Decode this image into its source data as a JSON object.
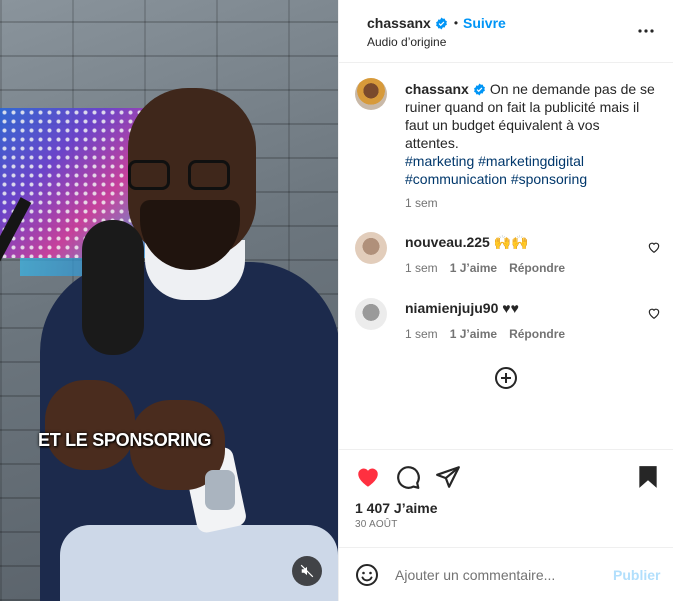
{
  "media": {
    "overlay_text": "ET LE SPONSORING",
    "mute_icon": "speaker-muted-icon"
  },
  "header": {
    "username": "chassanx",
    "separator": "•",
    "follow_label": "Suivre",
    "audio_label": "Audio d’origine",
    "verified_icon": "verified-badge-icon",
    "more_icon": "more-options-icon"
  },
  "caption": {
    "username": "chassanx",
    "text": "On ne demande pas de se ruiner quand on fait la publicité mais il faut un budget équivalent à vos attentes.",
    "hashtags": "#marketing #marketingdigital #communication #sponsoring",
    "time": "1 sem"
  },
  "comments": [
    {
      "username": "nouveau.225",
      "text": "🙌🙌",
      "time": "1 sem",
      "likes": "1 J’aime",
      "reply": "Répondre"
    },
    {
      "username": "niamienjuju90",
      "text": "♥♥",
      "time": "1 sem",
      "likes": "1 J’aime",
      "reply": "Répondre"
    }
  ],
  "actions": {
    "likes": "1 407 J’aime",
    "date": "30 AOÛT",
    "like_color": "#ff3040"
  },
  "add_comment": {
    "placeholder": "Ajouter un commentaire...",
    "publish_label": "Publier",
    "publish_color": "#b2dffc"
  },
  "colors": {
    "link_blue": "#0095f6",
    "hashtag": "#00376b",
    "muted_text": "#737373"
  }
}
